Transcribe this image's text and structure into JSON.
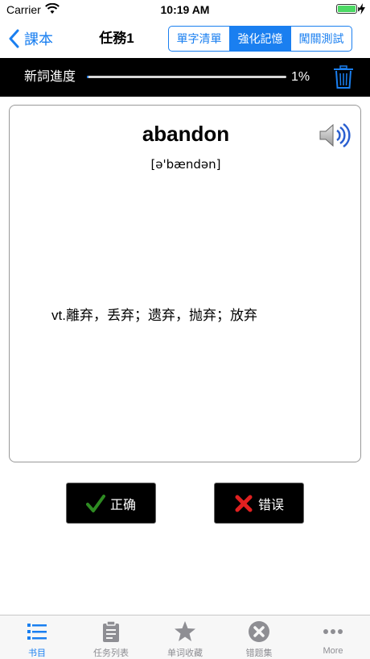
{
  "status_bar": {
    "carrier": "Carrier",
    "time": "10:19 AM"
  },
  "nav": {
    "back_label": "課本",
    "title": "任務1",
    "segments": [
      "單字清單",
      "強化記憶",
      "闖關測試"
    ],
    "active_segment": 1
  },
  "progress": {
    "label": "新詞進度",
    "percent_text": "1%",
    "value": 0.01
  },
  "card": {
    "word": "abandon",
    "phonetic": "[ə'bændən]",
    "meaning": "vt.離弃，丢弃；遗弃，抛弃；放弃"
  },
  "answers": {
    "correct_label": "正确",
    "wrong_label": "错误"
  },
  "tabs": [
    {
      "label": "书目",
      "icon": "list-icon",
      "active": true
    },
    {
      "label": "任务列表",
      "icon": "clipboard-icon",
      "active": false
    },
    {
      "label": "单词收藏",
      "icon": "star-icon",
      "active": false
    },
    {
      "label": "错题集",
      "icon": "x-circle-icon",
      "active": false
    },
    {
      "label": "More",
      "icon": "more-icon",
      "active": false
    }
  ],
  "colors": {
    "accent": "#1a7ff0",
    "correct": "#2e8b22",
    "wrong": "#e02020"
  }
}
